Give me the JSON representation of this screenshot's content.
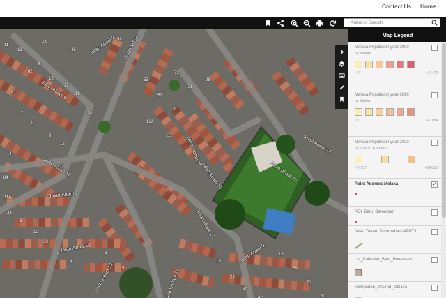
{
  "nav": {
    "contact": "Contact Us",
    "home": "Home"
  },
  "toolbar": {
    "buttons": [
      {
        "icon": "bookmark-icon"
      },
      {
        "icon": "share-icon"
      },
      {
        "icon": "zoom-in-icon"
      },
      {
        "icon": "zoom-out-icon"
      },
      {
        "icon": "print-icon"
      },
      {
        "icon": "refresh-icon"
      }
    ],
    "search_placeholder": "Address Search"
  },
  "map": {
    "roads": [
      "Jalan Abadi 6",
      "Jalan Abadi 17",
      "Jalan Abadi 7",
      "Jalan Abadi 22",
      "Jalan Abadi 18",
      "Jalan Abadi 16",
      "Jalan Abadi 9",
      "Jalan Abadi 15",
      "Jalan Abadi 14",
      "Jalan Abadi 11",
      "Jalan Abadi 10",
      "Jalan Abadi 12",
      "Jalan MTPA",
      "Jalan Abadi 3"
    ],
    "house_numbers": [
      "11",
      "13",
      "23",
      "45",
      "58",
      "6",
      "62",
      "15",
      "17",
      "18",
      "20",
      "24",
      "7",
      "8",
      "9",
      "12",
      "14",
      "53",
      "57",
      "81",
      "84",
      "11A",
      "13A",
      "31",
      "33",
      "6",
      "10",
      "38",
      "2",
      "4",
      "3",
      "5",
      "19",
      "21",
      "40",
      "42",
      "16",
      "69",
      "71",
      "73",
      "26",
      "28",
      "30"
    ]
  },
  "legend": {
    "title": "Map Legend",
    "side_icons": [
      "chevron-right-icon",
      "layers-icon",
      "image-icon",
      "edit-icon",
      "bookmark-icon"
    ],
    "layers": [
      {
        "name": "Melaka Population year 2000",
        "sub": "by Mukim",
        "checked": false,
        "min": "~27",
        "max": "~31470",
        "colors": [
          "#f9eeb9",
          "#f8dfa6",
          "#f5c99a",
          "#ef9f8e",
          "#e47982",
          "#d95f76"
        ]
      },
      {
        "name": "Melaka Population year 2010",
        "sub": "by Mukim",
        "checked": false,
        "min": "~8",
        "max": "~41884",
        "colors": [
          "#f9eeb9",
          "#f8e2a7",
          "#f6d39c",
          "#f3be94",
          "#efa88e",
          "#e88f88"
        ]
      },
      {
        "name": "Melaka Population year 2020",
        "sub": "by District (Daerah)",
        "checked": false,
        "min": "~77957",
        "max": "~286316",
        "colors": [
          "#f9f1c4",
          "#f7dea2",
          "#f2c18c"
        ]
      },
      {
        "name": "Point Address Melaka",
        "sub": "",
        "checked": true,
        "symbol": "point"
      },
      {
        "name": "POI_Batu_Berendam",
        "sub": "",
        "checked": false,
        "symbol": "point"
      },
      {
        "name": "Jalan Taman Perumahan MPHTJ",
        "sub": "",
        "checked": false,
        "symbol": "line"
      },
      {
        "name": "Lot_Kadaster_Batu_Berendam",
        "sub": "",
        "checked": false,
        "symbol": "polygon"
      },
      {
        "name": "Sempadan_Poskod_Melaka",
        "sub": "",
        "checked": false,
        "symbol": "polygon-light"
      }
    ],
    "check_mark": "✓"
  }
}
